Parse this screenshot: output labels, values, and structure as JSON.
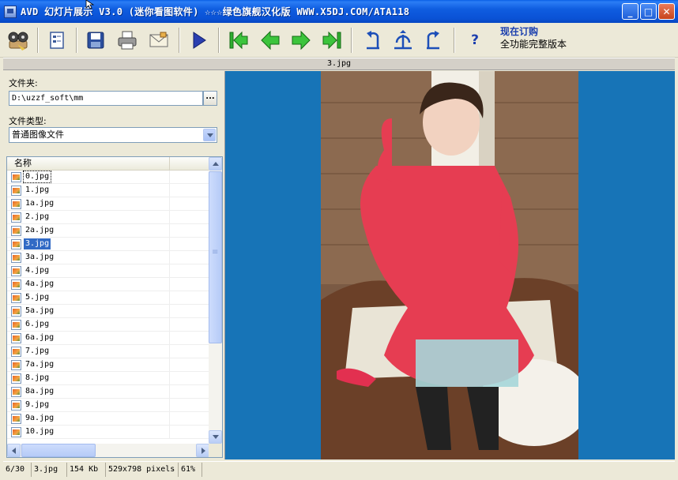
{
  "window": {
    "title": "AVD 幻灯片展示 V3.0  (迷你看图软件)  ☆☆☆绿色旗舰汉化版  WWW.X5DJ.COM/ATA118",
    "minimize": "_",
    "maximize": "□",
    "close": "✕"
  },
  "toolbar": {
    "buttons": [
      {
        "name": "slideshow-icon"
      },
      {
        "name": "properties-icon"
      },
      {
        "name": "save-icon"
      },
      {
        "name": "print-icon"
      },
      {
        "name": "email-icon"
      },
      {
        "name": "play-icon"
      },
      {
        "name": "first-icon"
      },
      {
        "name": "previous-icon"
      },
      {
        "name": "next-icon"
      },
      {
        "name": "last-icon"
      },
      {
        "name": "rotate-left-icon"
      },
      {
        "name": "flip-icon"
      },
      {
        "name": "rotate-right-icon"
      },
      {
        "name": "help-icon"
      }
    ],
    "help_label": "?",
    "order_line1": "现在订购",
    "order_line2": "全功能完整版本"
  },
  "current_file": "3.jpg",
  "left": {
    "folder_label": "文件夹:",
    "folder_value": "D:\\uzzf_soft\\mm",
    "browse_label": "...",
    "type_label": "文件类型:",
    "type_value": "普通图像文件",
    "list_header": "名称",
    "files": [
      "0.jpg",
      "1.jpg",
      "1a.jpg",
      "2.jpg",
      "2a.jpg",
      "3.jpg",
      "3a.jpg",
      "4.jpg",
      "4a.jpg",
      "5.jpg",
      "5a.jpg",
      "6.jpg",
      "6a.jpg",
      "7.jpg",
      "7a.jpg",
      "8.jpg",
      "8a.jpg",
      "9.jpg",
      "9a.jpg",
      "10.jpg"
    ],
    "selected_index": 5,
    "focus_index": 0
  },
  "status": {
    "position": "6/30",
    "file": "3.jpg",
    "size": "154 Kb",
    "dimensions": "529x798 pixels",
    "zoom": "61%"
  },
  "colors": {
    "viewer_bg": "#1774b7",
    "selection": "#316ac5",
    "titlebar": "#0a52d6"
  }
}
